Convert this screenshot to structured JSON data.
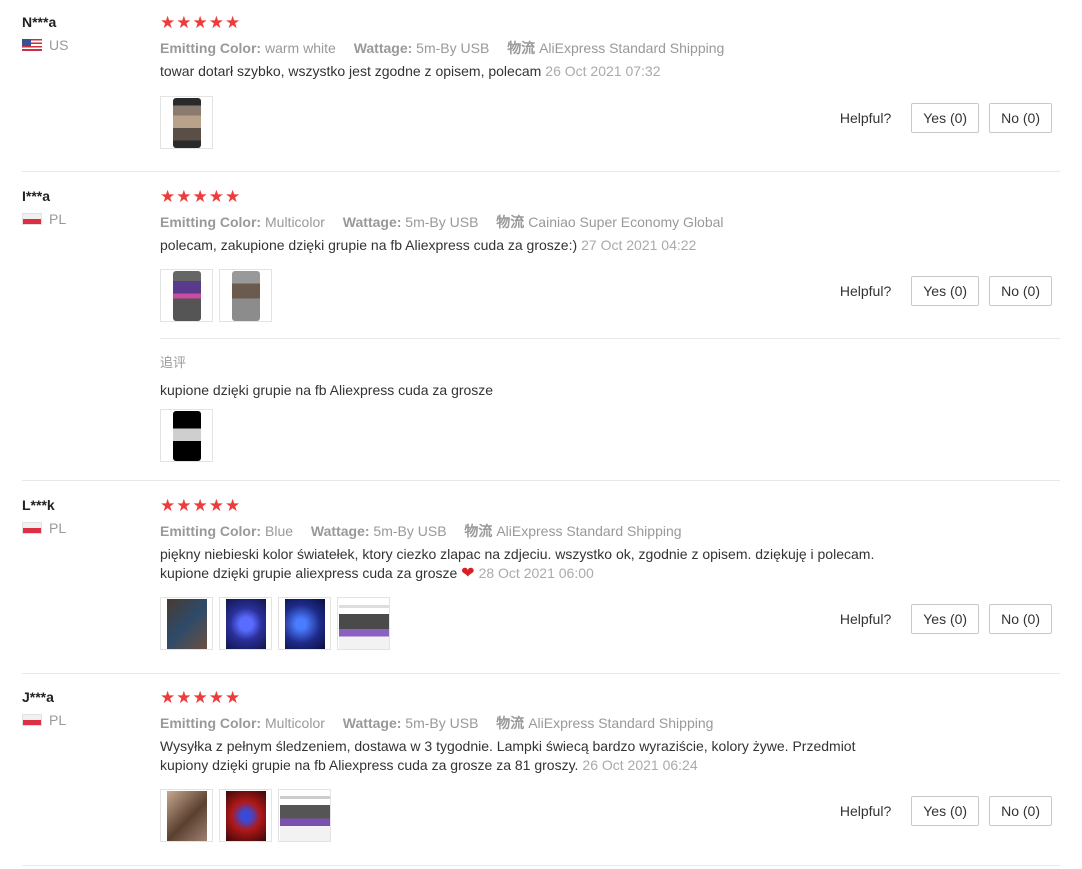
{
  "labels": {
    "emitting_color": "Emitting Color:",
    "wattage": "Wattage:",
    "shipping": "物流",
    "helpful": "Helpful?",
    "followup": "追评"
  },
  "colors": {
    "star": "#ee3b3b",
    "muted": "#999999"
  },
  "reviews": [
    {
      "user": "N***a",
      "country": "US",
      "rating": 5,
      "emitting_color": "warm white",
      "wattage": "5m-By USB",
      "shipping": "AliExpress Standard Shipping",
      "text": "towar dotarł szybko, wszystko jest zgodne z opisem, polecam",
      "date": "26 Oct 2021 07:32",
      "yes": "Yes (0)",
      "no": "No (0)"
    },
    {
      "user": "I***a",
      "country": "PL",
      "rating": 5,
      "emitting_color": "Multicolor",
      "wattage": "5m-By USB",
      "shipping": "Cainiao Super Economy Global",
      "text": "polecam, zakupione dzięki grupie na fb Aliexpress cuda za grosze:)",
      "date": "27 Oct 2021 04:22",
      "yes": "Yes (0)",
      "no": "No (0)",
      "followup_text": "kupione dzięki grupie na fb Aliexpress cuda za grosze"
    },
    {
      "user": "L***k",
      "country": "PL",
      "rating": 5,
      "emitting_color": "Blue",
      "wattage": "5m-By USB",
      "shipping": "AliExpress Standard Shipping",
      "text_line1": "piękny niebieski kolor światełek, ktory ciezko zlapac na zdjeciu. wszystko ok, zgodnie z opisem. dziękuję i polecam.",
      "text_line2": "kupione dzięki grupie aliexpress cuda za grosze",
      "date": "28 Oct 2021 06:00",
      "yes": "Yes (0)",
      "no": "No (0)"
    },
    {
      "user": "J***a",
      "country": "PL",
      "rating": 5,
      "emitting_color": "Multicolor",
      "wattage": "5m-By USB",
      "shipping": "AliExpress Standard Shipping",
      "text_line1": "Wysyłka z pełnym śledzeniem, dostawa w 3 tygodnie. Lampki świecą bardzo wyraziście, kolory żywe. Przedmiot",
      "text_line2": "kupiony dzięki grupie na fb Aliexpress cuda za grosze za 81 groszy.",
      "date": "26 Oct 2021 06:24",
      "yes": "Yes (0)",
      "no": "No (0)"
    }
  ]
}
